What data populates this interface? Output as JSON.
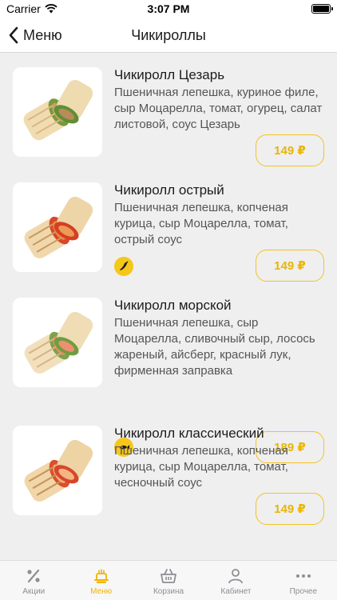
{
  "status_bar": {
    "carrier": "Carrier",
    "time": "3:07 PM"
  },
  "nav": {
    "back_label": "Меню",
    "title": "Чикироллы"
  },
  "items": [
    {
      "title": "Чикиролл Цезарь",
      "description": "Пшеничная лепешка, куриное филе, сыр Моцарелла, томат, огурец, салат листовой, соус Цезарь",
      "price": "149 ₽"
    },
    {
      "title": "Чикиролл острый",
      "description": "Пшеничная лепешка, копченая курица, сыр Моцарелла, томат, острый соус",
      "price": "149 ₽",
      "badge_icon": "chili-pepper-icon"
    },
    {
      "title": "Чикиролл морской",
      "description": "Пшеничная лепешка, сыр Моцарелла, сливочный сыр, лосось жареный, айсберг, красный лук, фирменная заправка",
      "price": "189 ₽",
      "badge_icon": "fish-icon"
    },
    {
      "title": "Чикиролл классический",
      "description": "Пшеничная лепешка, копченая курица, сыр Моцарелла, томат, чесночный  соус",
      "price": "149 ₽"
    }
  ],
  "tabs": [
    {
      "label": "Акции",
      "icon": "percent-icon",
      "active": false
    },
    {
      "label": "Меню",
      "icon": "menu-food-icon",
      "active": true
    },
    {
      "label": "Корзина",
      "icon": "basket-icon",
      "active": false
    },
    {
      "label": "Кабинет",
      "icon": "user-icon",
      "active": false
    },
    {
      "label": "Прочее",
      "icon": "more-icon",
      "active": false
    }
  ],
  "colors": {
    "accent": "#f0b400",
    "price_border": "#f3c320",
    "badge": "#f5c71a"
  }
}
